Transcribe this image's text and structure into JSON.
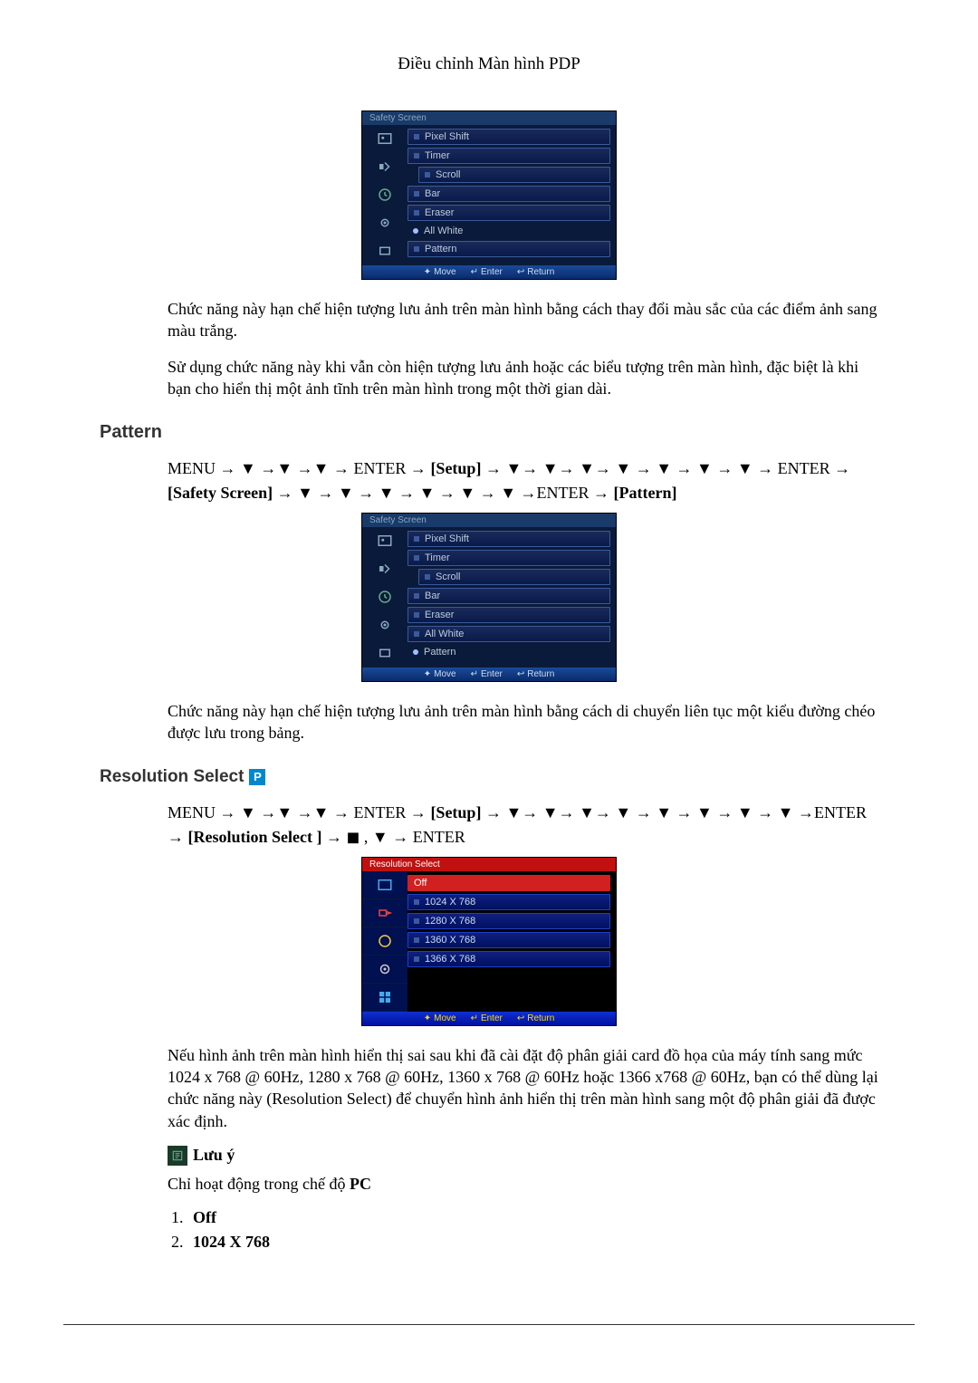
{
  "header": {
    "title": "Điều chỉnh Màn hình PDP"
  },
  "osd1": {
    "title": "Safety Screen",
    "items": [
      "Pixel Shift",
      "Timer",
      "Scroll",
      "Bar",
      "Eraser",
      "All White",
      "Pattern"
    ],
    "selected_index": 5,
    "footer": {
      "move": "Move",
      "enter": "Enter",
      "return": "Return"
    }
  },
  "para1": "Chức năng này hạn chế hiện tượng lưu ảnh trên màn hình bằng cách thay đổi màu sắc của các điểm ảnh sang màu trắng.",
  "para2": "Sử dụng chức năng này khi vẫn còn hiện tượng lưu ảnh hoặc các biểu tượng trên màn hình, đặc biệt là khi bạn cho hiển thị một ảnh tĩnh trên màn hình trong một thời gian dài.",
  "pattern": {
    "heading": "Pattern",
    "path_prefix": "MENU → ▼ →▼ →▼ → ENTER → ",
    "path_setup": "[Setup]",
    "path_mid": " → ▼→ ▼→ ▼→ ▼ → ▼ → ▼ → ▼ → ENTER → ",
    "path_safety": "[Safety Screen]",
    "path_mid2": " → ▼ → ▼ → ▼ → ▼ → ▼ → ▼ →ENTER → ",
    "path_pattern": "[Pattern]"
  },
  "osd2": {
    "title": "Safety Screen",
    "items": [
      "Pixel Shift",
      "Timer",
      "Scroll",
      "Bar",
      "Eraser",
      "All White",
      "Pattern"
    ],
    "selected_index": 6,
    "footer": {
      "move": "Move",
      "enter": "Enter",
      "return": "Return"
    }
  },
  "para3": "Chức năng này hạn chế hiện tượng lưu ảnh trên màn hình bằng cách di chuyển liên tục một kiểu đường chéo được lưu trong bảng.",
  "resolution": {
    "heading": "Resolution Select",
    "badge": "P",
    "path_prefix": "MENU → ▼ →▼ →▼ → ENTER → ",
    "path_setup": "[Setup]",
    "path_mid": " → ▼→ ▼→ ▼→ ▼ → ▼ → ▼ → ▼ → ▼ →ENTER → ",
    "path_rs": "[Resolution Select ]",
    "path_end": " → ◼ , ▼ → ENTER"
  },
  "osd3": {
    "title": "Resolution Select",
    "items": [
      "Off",
      "1024 X 768",
      "1280 X 768",
      "1360 X 768",
      "1366 X 768"
    ],
    "selected_index": 0,
    "footer": {
      "move": "Move",
      "enter": "Enter",
      "return": "Return"
    }
  },
  "para4": "Nếu hình ảnh trên màn hình hiển thị sai sau khi đã cài đặt độ phân giải card đồ họa của máy tính sang mức 1024 x 768 @ 60Hz, 1280 x 768 @ 60Hz, 1360 x 768 @ 60Hz hoặc 1366 x768 @ 60Hz, bạn có thể dùng lại chức năng này (Resolution Select) để chuyển hình ảnh hiển thị trên màn hình sang một độ phân giải đã được xác định.",
  "note": {
    "label": "Lưu ý"
  },
  "para5_prefix": "Chỉ hoạt động trong chế độ ",
  "para5_bold": "PC",
  "options": [
    "Off",
    "1024 X 768"
  ]
}
